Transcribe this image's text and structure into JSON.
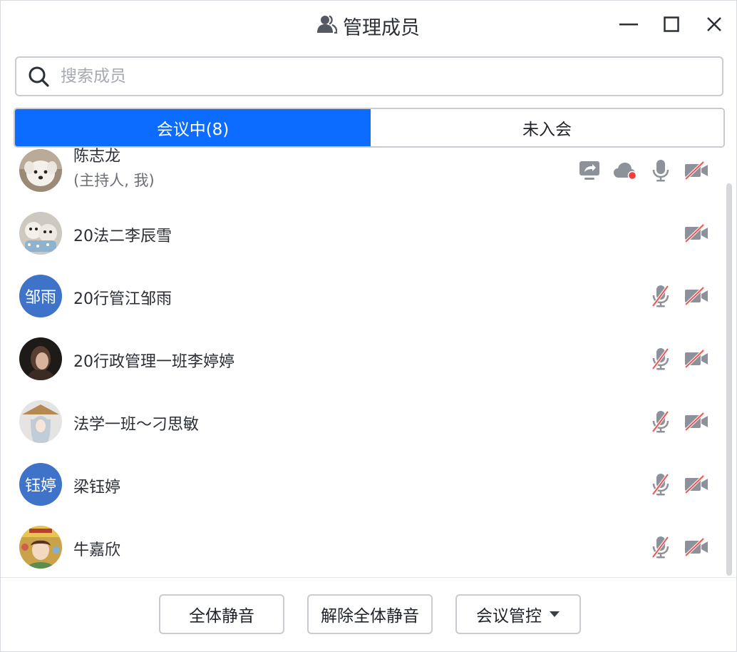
{
  "window": {
    "title": "管理成员",
    "icons": {
      "title": "people-icon",
      "minimize": "minimize-icon",
      "maximize": "maximize-icon",
      "close": "close-icon"
    }
  },
  "search": {
    "placeholder": "搜索成员",
    "value": "",
    "icon": "search-icon"
  },
  "tabs": [
    {
      "label": "会议中(8)",
      "active": true
    },
    {
      "label": "未入会",
      "active": false
    }
  ],
  "members": [
    {
      "name": "陈志龙",
      "subtitle": "(主持人, 我)",
      "avatar_type": "photo",
      "avatar_icon": "dog-photo-avatar",
      "share_screen": true,
      "cloud_record": true,
      "mic": "on",
      "camera": "off"
    },
    {
      "name": "20法二李辰雪",
      "avatar_type": "photo",
      "avatar_icon": "plush-toy-photo-avatar",
      "mic": "none",
      "camera": "off"
    },
    {
      "name": "20行管江邹雨",
      "avatar_type": "text",
      "avatar_text": "邹雨",
      "mic": "muted",
      "camera": "off"
    },
    {
      "name": "20行政管理一班李婷婷",
      "avatar_type": "photo",
      "avatar_icon": "portrait-photo-avatar",
      "mic": "muted",
      "camera": "off"
    },
    {
      "name": "法学一班～刁思敏",
      "avatar_type": "photo",
      "avatar_icon": "illustration-photo-avatar",
      "mic": "muted",
      "camera": "off"
    },
    {
      "name": "梁钰婷",
      "avatar_type": "text",
      "avatar_text": "钰婷",
      "mic": "muted",
      "camera": "off"
    },
    {
      "name": "牛嘉欣",
      "avatar_type": "photo",
      "avatar_icon": "colorful-photo-avatar",
      "mic": "muted",
      "camera": "off"
    }
  ],
  "footer": {
    "mute_all": "全体静音",
    "unmute_all": "解除全体静音",
    "meeting_control": "会议管控"
  },
  "colors": {
    "accent": "#0b6cff",
    "avatar_blue": "#3f72c9",
    "icon_gray": "#8d9199",
    "muted_red": "#f25454",
    "record_red": "#f53b3b"
  }
}
